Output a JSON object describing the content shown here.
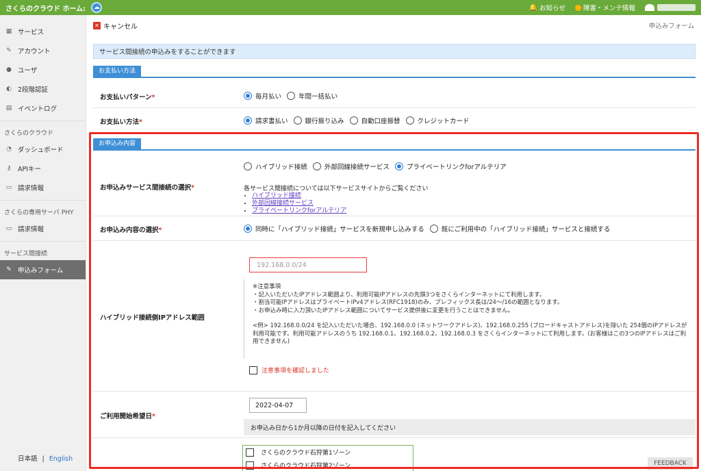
{
  "topbar": {
    "home_title": "さくらのクラウド ホーム:",
    "news": "お知らせ",
    "maintenance": "障害・メンテ情報"
  },
  "sidebar": {
    "items": [
      {
        "label": "サービス",
        "icon": "grid-icon"
      },
      {
        "label": "アカウント",
        "icon": "wrench-icon"
      },
      {
        "label": "ユーザ",
        "icon": "users-icon"
      },
      {
        "label": "2段階認証",
        "icon": "shield-icon"
      },
      {
        "label": "イベントログ",
        "icon": "clipboard-icon"
      }
    ],
    "cloud_section": "さくらのクラウド",
    "cloud_items": [
      {
        "label": "ダッシュボード",
        "icon": "dashboard-icon"
      },
      {
        "label": "APIキー",
        "icon": "key-icon"
      },
      {
        "label": "請求情報",
        "icon": "invoice-icon"
      }
    ],
    "phy_section": "さくらの専用サーバ PHY",
    "phy_items": [
      {
        "label": "請求情報",
        "icon": "invoice-icon"
      }
    ],
    "conn_section": "サービス間接続",
    "conn_items": [
      {
        "label": "申込みフォーム",
        "icon": "wrench-icon"
      }
    ],
    "lang_ja": "日本語",
    "lang_sep": "|",
    "lang_en": "English"
  },
  "header": {
    "cancel": "キャンセル",
    "page_name": "申込みフォーム",
    "info": "サービス間接続の申込みをすることができます"
  },
  "payment": {
    "section": "お支払い方法",
    "pattern_label": "お支払いパターン",
    "pattern_options": [
      "毎月払い",
      "年間一括払い"
    ],
    "method_label": "お支払い方法",
    "method_options": [
      "請求書払い",
      "銀行振り込み",
      "自動口座振替",
      "クレジットカード"
    ]
  },
  "application": {
    "section": "お申込み内容",
    "service_label": "お申込みサービス間接続の選択",
    "service_options": [
      "ハイブリッド接続",
      "外部回線接続サービス",
      "プライベートリンクforアルテリア"
    ],
    "service_note": "各サービス間接続については以下サービスサイトからご覧ください",
    "service_links": [
      "ハイブリッド接続",
      "外部回線接続サービス",
      "プライベートリンクforアルテリア"
    ],
    "content_label": "お申込み内容の選択",
    "content_options": [
      "同時に「ハイブリッド接続」サービスを新規申し込みする",
      "既にご利用中の「ハイブリッド接続」サービスと接続する"
    ],
    "ip_label": "ハイブリッド接続側IPアドレス範囲",
    "ip_placeholder": "192.168.0.0/24",
    "ip_notes": [
      "※注意事項",
      "・記入いただいたIPアドレス範囲より、利用可能IPアドレスの先頭3つをさくらインターネットにて利用します。",
      "・割当可能IPアドレスはプライベートIPv4アドレス(RFC1918)のみ、プレフィックス長は/24〜/16の範囲となります。",
      "・お申込み時に入力頂いたIPアドレス範囲についてサービス提供後に変更を行うことはできません。",
      "",
      "<例> 192.168.0.0/24 を記入いただいた場合、192.168.0.0 (ネットワークアドレス)、192.168.0.255 (ブロードキャストアドレス)を除いた 254個のIPアドレスが利用可能です。利用可能アドレスのうち 192.168.0.1、192.168.0.2、192.168.0.3 をさくらインターネットにて利用します。(お客様はこの3つのIPアドレスはご利用できません)"
    ],
    "ip_confirm": "注意事項を確認しました",
    "date_label": "ご利用開始希望日",
    "date_value": "2022-04-07",
    "date_note": "お申込み日から1か月以降の日付を記入してください",
    "zones": [
      "さくらのクラウド石狩第1ゾーン",
      "さくらのクラウド石狩第2ゾーン"
    ]
  },
  "feedback": "FEEDBACK",
  "colors": {
    "topbar": "#6aaa3a",
    "accent": "#3e8fd6",
    "highlight_frame": "#ee2a24"
  }
}
